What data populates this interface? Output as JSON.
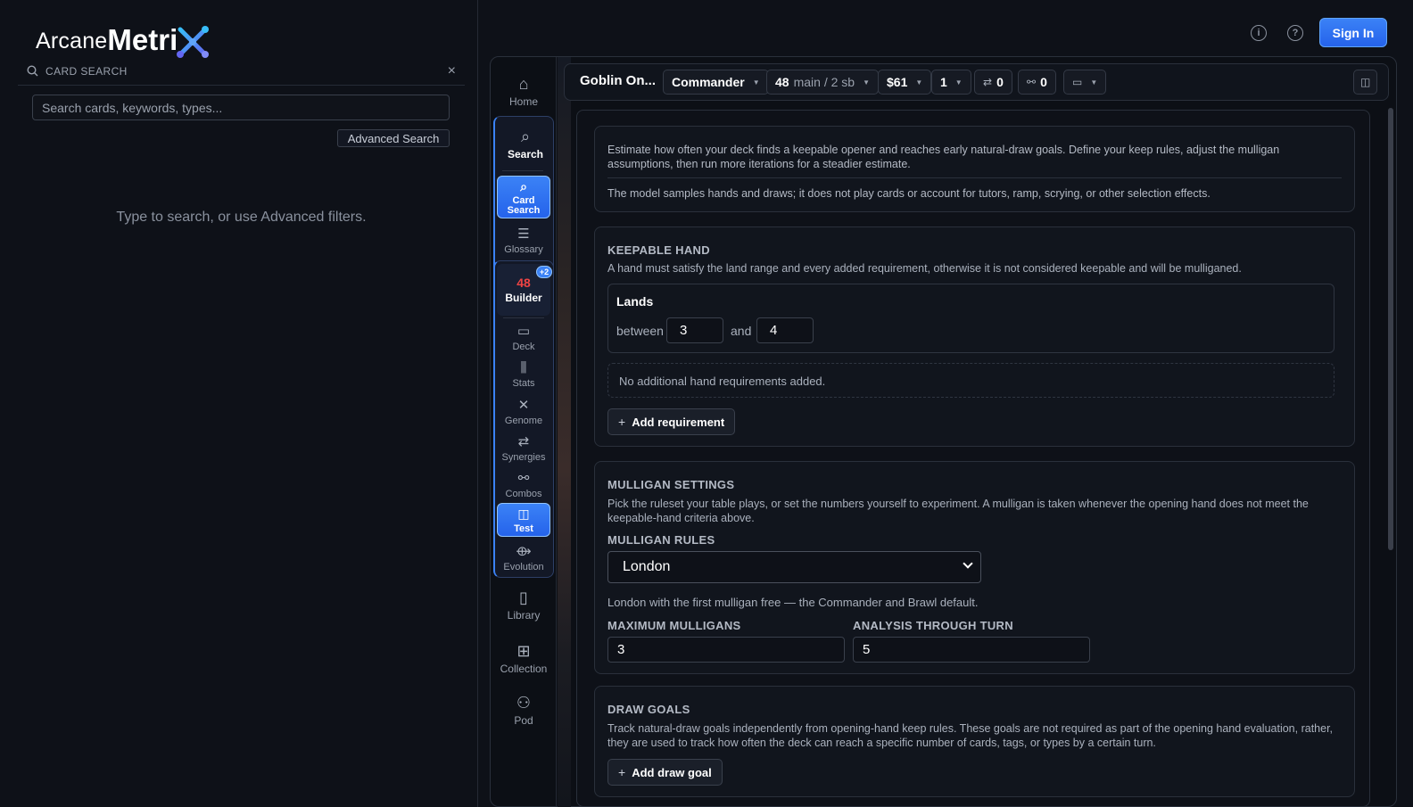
{
  "header": {
    "logo_arcane": "Arcane",
    "logo_metri": "Metri",
    "info_icon": "info-icon",
    "help_icon": "help-icon",
    "signin_label": "Sign In"
  },
  "card_search": {
    "title": "CARD SEARCH",
    "close": "×",
    "placeholder": "Search cards, keywords, types...",
    "advanced_label": "Advanced Search",
    "empty_text": "Type to search, or use Advanced filters."
  },
  "nav": {
    "home": "Home",
    "search": "Search",
    "card_search": "Card Search",
    "glossary": "Glossary",
    "builder_count": "48",
    "builder_badge": "+2",
    "builder": "Builder",
    "deck": "Deck",
    "stats": "Stats",
    "genome": "Genome",
    "synergies": "Synergies",
    "combos": "Combos",
    "test": "Test",
    "evolution": "Evolution",
    "library": "Library",
    "collection": "Collection",
    "pod": "Pod"
  },
  "toolbar": {
    "deck_name": "Goblin On...",
    "format": "Commander",
    "main_count": "48",
    "main_rest": "main / 2 sb",
    "price": "$61",
    "copies": "1",
    "swap_count": "0",
    "link_count": "0"
  },
  "intro": {
    "text1": "Estimate how often your deck finds a keepable opener and reaches early natural-draw goals. Define your keep rules, adjust the mulligan assumptions, then run more iterations for a steadier estimate.",
    "text2": "The model samples hands and draws; it does not play cards or account for tutors, ramp, scrying, or other selection effects."
  },
  "keepable": {
    "title": "KEEPABLE HAND",
    "desc": "A hand must satisfy the land range and every added requirement, otherwise it is not considered keepable and will be mulliganed.",
    "lands_title": "Lands",
    "between": "between",
    "and": "and",
    "min": "3",
    "max": "4",
    "no_reqs": "No additional hand requirements added.",
    "add_req": "Add requirement"
  },
  "mulligan": {
    "title": "MULLIGAN SETTINGS",
    "desc": "Pick the ruleset your table plays, or set the numbers yourself to experiment. A mulligan is taken whenever the opening hand does not meet the keepable-hand criteria above.",
    "rules_label": "MULLIGAN RULES",
    "rules_value": "London",
    "rules_note": "London with the first mulligan free — the Commander and Brawl default.",
    "max_label": "MAXIMUM MULLIGANS",
    "max_value": "3",
    "turn_label": "ANALYSIS THROUGH TURN",
    "turn_value": "5"
  },
  "draw_goals": {
    "title": "DRAW GOALS",
    "desc": "Track natural-draw goals independently from opening-hand keep rules. These goals are not required as part of the opening hand evaluation, rather, they are used to track how often the deck can reach a specific number of cards, tags, or types by a certain turn.",
    "add_goal": "Add draw goal"
  }
}
